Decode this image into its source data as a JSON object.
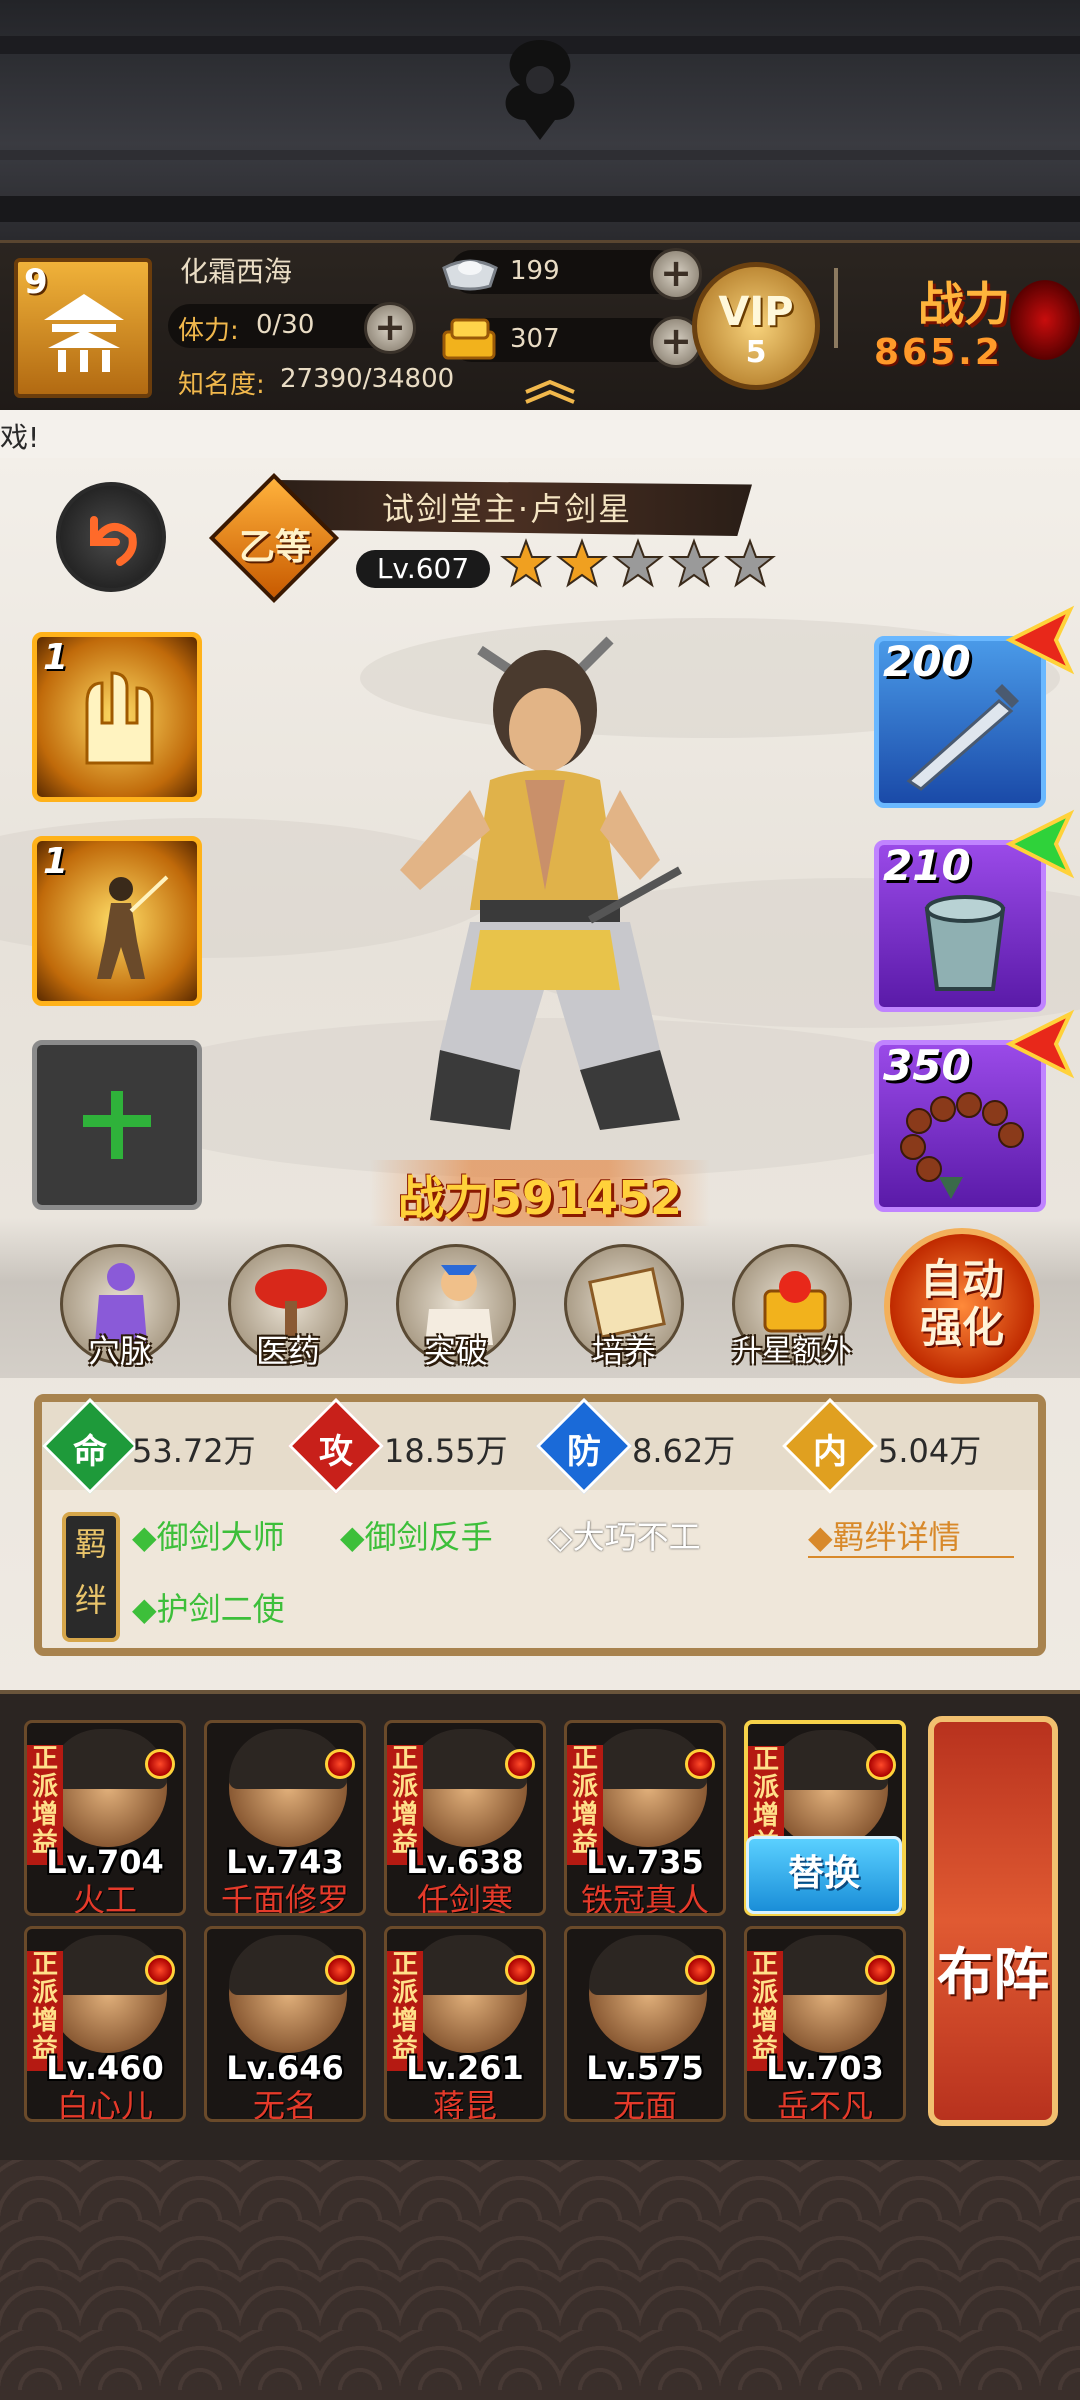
{
  "header": {
    "player_level": "9",
    "player_name": "化霜西海",
    "stamina_label": "体力:",
    "stamina_value": "0/30",
    "fame_label": "知名度:",
    "fame_value": "27390/34800",
    "silver": "199",
    "gold": "307",
    "vip_label": "VIP",
    "vip_level": "5",
    "power_label": "战力",
    "power_value": "865.2"
  },
  "notice": "戏!",
  "hero": {
    "title": "试剑堂主·卢剑星",
    "grade": "乙等",
    "level": "Lv.607",
    "stars_filled": 2,
    "stars_total": 5,
    "battle_power_label": "战力",
    "battle_power_value": "591452"
  },
  "skills": [
    {
      "count": "1",
      "icon": "martial-skill-icon"
    },
    {
      "count": "1",
      "icon": "sword-dance-skill-icon"
    }
  ],
  "equipment": [
    {
      "level": "200",
      "icon": "sword-icon",
      "color": "#2a64c8",
      "arrow": "upgrade-arrow-red-icon"
    },
    {
      "level": "210",
      "icon": "bracer-icon",
      "color": "#7a2bc4",
      "arrow": "upgrade-arrow-green-icon"
    },
    {
      "level": "350",
      "icon": "prayer-beads-icon",
      "color": "#7a2bc4",
      "arrow": "upgrade-arrow-red-icon"
    }
  ],
  "functions": [
    "穴脉",
    "医药",
    "突破",
    "培养",
    "升星额外"
  ],
  "auto_button": "自动强化",
  "stats": [
    {
      "char": "命",
      "value": "53.72万",
      "color": "#1e9a3a"
    },
    {
      "char": "攻",
      "value": "18.55万",
      "color": "#c8201a"
    },
    {
      "char": "防",
      "value": "8.62万",
      "color": "#1a6ad8"
    },
    {
      "char": "内",
      "value": "5.04万",
      "color": "#e0a020"
    }
  ],
  "bonds": {
    "tag": "羁绊",
    "items": [
      {
        "text": "◆御剑大师",
        "active": true
      },
      {
        "text": "◆御剑反手",
        "active": true
      },
      {
        "text": "◇大巧不工",
        "active": false
      },
      {
        "text": "◆护剑二使",
        "active": true
      }
    ],
    "detail": "◆羁绊详情"
  },
  "roster": [
    {
      "lv": "Lv.704",
      "name": "火工",
      "ribbon": true
    },
    {
      "lv": "Lv.743",
      "name": "千面修罗",
      "ribbon": false
    },
    {
      "lv": "Lv.638",
      "name": "任剑寒",
      "ribbon": true
    },
    {
      "lv": "Lv.735",
      "name": "铁冠真人",
      "ribbon": true
    },
    {
      "lv": "",
      "name": "",
      "ribbon": true
    },
    {
      "lv": "Lv.460",
      "name": "白心儿",
      "ribbon": true
    },
    {
      "lv": "Lv.646",
      "name": "无名",
      "ribbon": false
    },
    {
      "lv": "Lv.261",
      "name": "蒋昆",
      "ribbon": true
    },
    {
      "lv": "Lv.575",
      "name": "无面",
      "ribbon": false
    },
    {
      "lv": "Lv.703",
      "name": "岳不凡",
      "ribbon": true
    }
  ],
  "ribbon_text": "正派增益",
  "replace_button": "替换",
  "formation_button": "布阵"
}
